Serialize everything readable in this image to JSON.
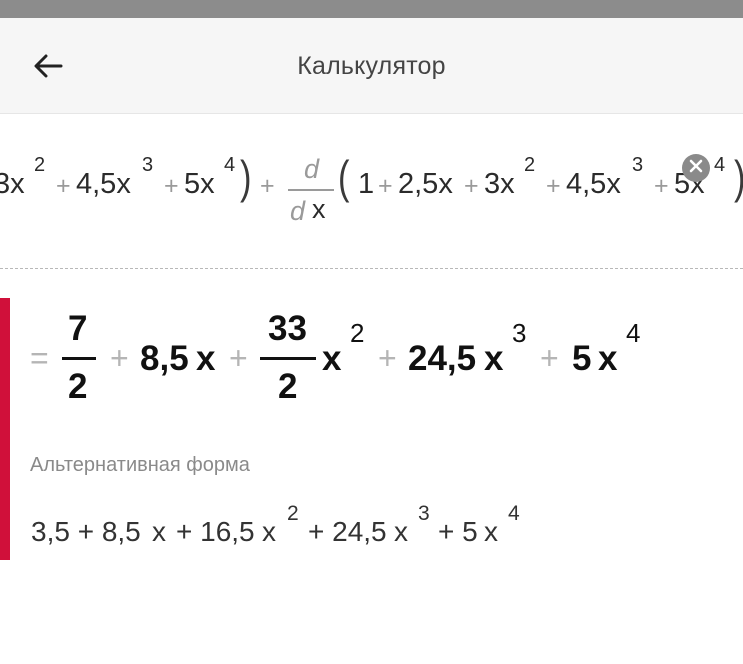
{
  "app_bar": {
    "title": "Калькулятор",
    "back_icon": "arrow-left-icon"
  },
  "input_expression": {
    "left_part": [
      "3x",
      "+",
      "4,5x",
      "+",
      "5x",
      "+"
    ],
    "left_exponents": [
      "2",
      "3",
      "4"
    ],
    "close_paren": ")",
    "derivative_numerator": "d",
    "derivative_denominator_d": "d",
    "derivative_denominator_var": "x",
    "open_paren": "(",
    "right_part": [
      "1",
      "+",
      "2,5x",
      "+",
      "3x",
      "+",
      "4,5x",
      "+",
      "5x"
    ],
    "right_exponents": [
      "2",
      "3",
      "4"
    ],
    "clear_icon": "clear-x-icon"
  },
  "result": {
    "equals": "=",
    "term1_num": "7",
    "term1_den": "2",
    "plus": "+",
    "term2": "8,5",
    "term2_var": "x",
    "term3_num": "33",
    "term3_den": "2",
    "term3_var": "x",
    "term3_exp": "2",
    "term4": "24,5",
    "term4_var": "x",
    "term4_exp": "3",
    "term5": "5",
    "term5_var": "x",
    "term5_exp": "4",
    "accent_color": "#d0103a"
  },
  "alternative": {
    "label": "Альтернативная форма",
    "t1": "3,5 + 8,5",
    "t1_var": "x",
    "t2": "+ 16,5",
    "t2_var": "x",
    "t2_exp": "2",
    "t3": "+ 24,5",
    "t3_var": "x",
    "t3_exp": "3",
    "t4": "+ 5",
    "t4_var": "x",
    "t4_exp": "4"
  }
}
